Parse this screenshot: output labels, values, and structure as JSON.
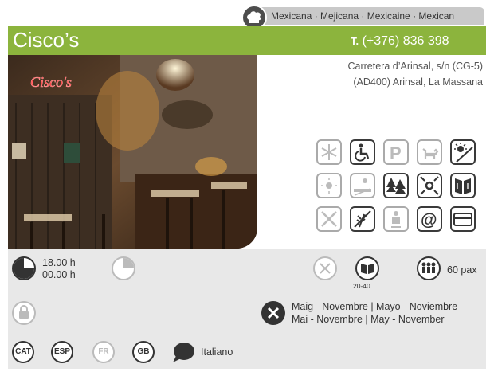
{
  "cuisine": "Mexicana  · Mejicana · Mexicaine · Mexican",
  "restaurant": {
    "name": "Cisco’s",
    "phone_prefix": "T.",
    "phone": " (+376) 836 398",
    "address_line1": "Carretera d’Arinsal, s/n (CG-5)",
    "address_line2": "(AD400) Arinsal, La Massana",
    "sign_text": "Cisco's"
  },
  "hours": {
    "open": "18.00 h",
    "close": "00.00 h"
  },
  "price": {
    "label": "20-40"
  },
  "capacity": "60 pax",
  "closed_period": {
    "line1": "Maig - Novembre | Mayo - Noviembre",
    "line2": "Mai - Novembre | May - November"
  },
  "languages": [
    {
      "code": "CAT",
      "active": true
    },
    {
      "code": "ESP",
      "active": true
    },
    {
      "code": "FR",
      "active": false
    },
    {
      "code": "GB",
      "active": true
    }
  ],
  "language_other": "Italiano",
  "facilities": [
    {
      "name": "air-conditioning-icon",
      "active": false
    },
    {
      "name": "wheelchair-access-icon",
      "active": true
    },
    {
      "name": "parking-icon",
      "active": false
    },
    {
      "name": "pets-allowed-icon",
      "active": false
    },
    {
      "name": "no-smoking-terrace-icon",
      "active": true
    },
    {
      "name": "terrace-sun-icon",
      "active": false
    },
    {
      "name": "sun-terrace-view-icon",
      "active": false
    },
    {
      "name": "forest-view-icon",
      "active": true
    },
    {
      "name": "center-location-icon",
      "active": true
    },
    {
      "name": "menu-book-icon",
      "active": true
    },
    {
      "name": "no-cutlery-icon",
      "active": false
    },
    {
      "name": "no-gluten-icon",
      "active": true
    },
    {
      "name": "baby-chair-icon",
      "active": false
    },
    {
      "name": "email-at-icon",
      "active": true
    },
    {
      "name": "credit-card-icon",
      "active": true
    }
  ],
  "colors": {
    "brand_green": "#8cb43d",
    "panel_gray": "#e8e8e8",
    "dark_icon": "#333333",
    "light_icon": "#bbbbbb"
  }
}
